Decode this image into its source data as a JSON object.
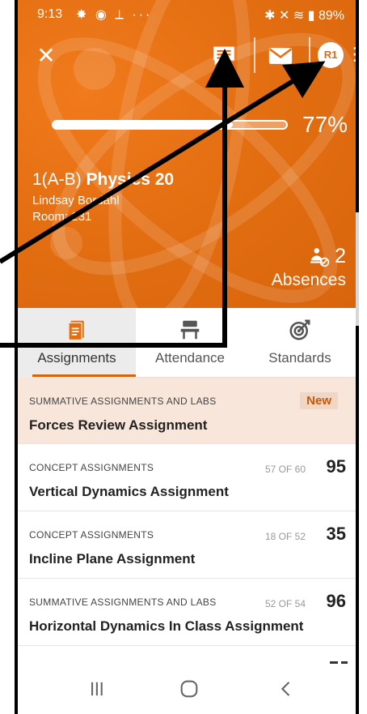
{
  "status": {
    "time": "9:13",
    "icons": "✸ ◉ ⟂ ···",
    "right": "✱ ✕ ≋ ▮ 89%",
    "battery": "89%"
  },
  "header": {
    "avatar": "R1",
    "progress_percent": 77,
    "progress_label": "77%",
    "class_prefix": "1(A-B)",
    "class_subject": "Physics 20",
    "teacher": "Lindsay Bordahl",
    "room": "Room: 231",
    "absences_count": "2",
    "absences_label": "Absences"
  },
  "tabs": [
    {
      "label": "Assignments",
      "icon": "assignment-icon",
      "selected": true
    },
    {
      "label": "Attendance",
      "icon": "desk-icon",
      "selected": false
    },
    {
      "label": "Standards",
      "icon": "target-icon",
      "selected": false
    }
  ],
  "assignments": [
    {
      "category": "SUMMATIVE ASSIGNMENTS AND LABS",
      "name": "Forces Review Assignment",
      "badge": "New"
    },
    {
      "category": "CONCEPT ASSIGNMENTS",
      "name": "Vertical Dynamics Assignment",
      "of": "57 OF 60",
      "score": "95"
    },
    {
      "category": "CONCEPT ASSIGNMENTS",
      "name": "Incline Plane Assignment",
      "of": "18 OF 52",
      "score": "35"
    },
    {
      "category": "SUMMATIVE ASSIGNMENTS AND LABS",
      "name": "Horizontal Dynamics In Class Assignment",
      "of": "52 OF 54",
      "score": "96"
    }
  ],
  "colors": {
    "accent": "#e46f12",
    "highlight": "#f8e6da"
  }
}
